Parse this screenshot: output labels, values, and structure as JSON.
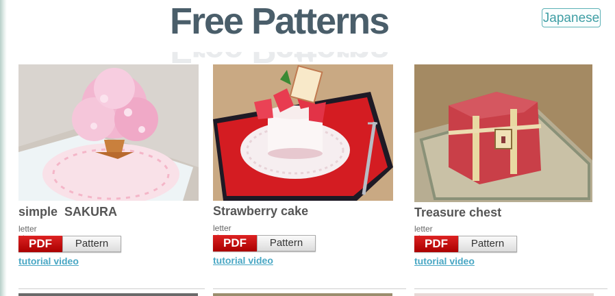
{
  "header": {
    "title": "Free Patterns",
    "language_button": "Japanese"
  },
  "patterns": [
    {
      "name": "simple  SAKURA",
      "paper_size": "letter size",
      "pdf_label": "PDF",
      "pattern_label": "Pattern",
      "video_link": "tutorial video"
    },
    {
      "name": "Strawberry cake",
      "paper_size": "letter size",
      "pdf_label": "PDF",
      "pattern_label": "Pattern",
      "video_link": "tutorial video"
    },
    {
      "name": "Treasure chest",
      "paper_size": "letter size",
      "pdf_label": "PDF",
      "pattern_label": "Pattern",
      "video_link": "tutorial video"
    }
  ],
  "colors": {
    "title": "#4a5e6a",
    "link": "#49a7c4",
    "pdf_red": "#c41a1a",
    "accent": "#3e9ea4"
  }
}
